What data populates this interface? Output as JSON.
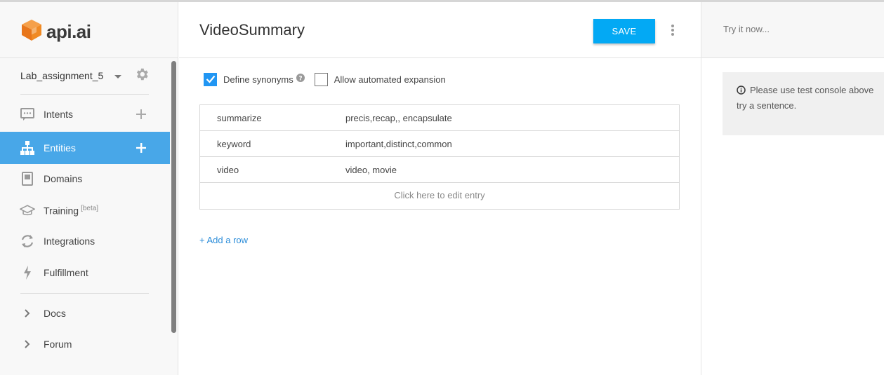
{
  "brand": {
    "logo_text": "api.ai",
    "accent": "#f08a24"
  },
  "sidebar": {
    "agent_name": "Lab_assignment_5",
    "items": [
      {
        "label": "Intents",
        "icon": "chat-icon"
      },
      {
        "label": "Entities",
        "icon": "hierarchy-icon",
        "active": true
      },
      {
        "label": "Domains",
        "icon": "book-icon"
      },
      {
        "label": "Training",
        "badge": "[beta]",
        "icon": "graduation-cap-icon"
      },
      {
        "label": "Integrations",
        "icon": "sync-icon"
      },
      {
        "label": "Fulfillment",
        "icon": "lightning-icon"
      },
      {
        "label": "Docs",
        "icon": "chevron-right-icon"
      },
      {
        "label": "Forum",
        "icon": "chevron-right-icon"
      }
    ],
    "active_color": "#48a7e8"
  },
  "main": {
    "title": "VideoSummary",
    "save_label": "SAVE",
    "options": {
      "define_synonyms": {
        "label": "Define synonyms",
        "checked": true
      },
      "allow_expansion": {
        "label": "Allow automated expansion",
        "checked": false
      }
    },
    "entries": [
      {
        "value": "summarize",
        "synonyms": "precis,recap,, encapsulate"
      },
      {
        "value": "keyword",
        "synonyms": "important,distinct,common"
      },
      {
        "value": "video",
        "synonyms": "video, movie"
      }
    ],
    "edit_entry_placeholder": "Click here to edit entry",
    "add_row_label": "+ Add a row"
  },
  "console": {
    "input_placeholder": "Try it now...",
    "info_text_line1": "Please use test console above",
    "info_text_line2": "try a sentence."
  }
}
